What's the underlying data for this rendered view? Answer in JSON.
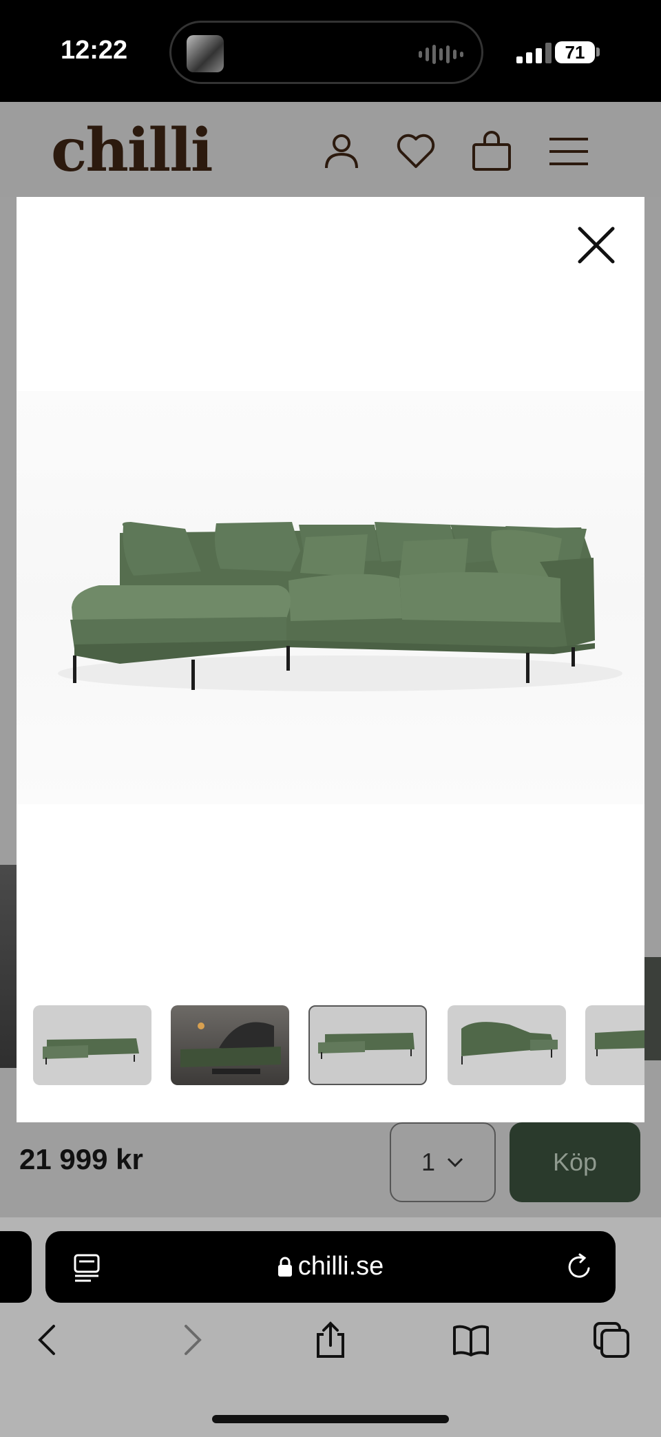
{
  "status_bar": {
    "time": "12:22",
    "battery": "71"
  },
  "site": {
    "logo": "chilli"
  },
  "product": {
    "price": "21 999 kr",
    "quantity": "1",
    "buy_label": "Köp"
  },
  "gallery": {
    "thumbnail_count": 5,
    "selected_index": 3
  },
  "browser": {
    "url": "chilli.se"
  },
  "colors": {
    "brand_brown": "#2c1a0e",
    "buy_green": "#2a3a2c",
    "sofa_green": "#5b7354"
  }
}
